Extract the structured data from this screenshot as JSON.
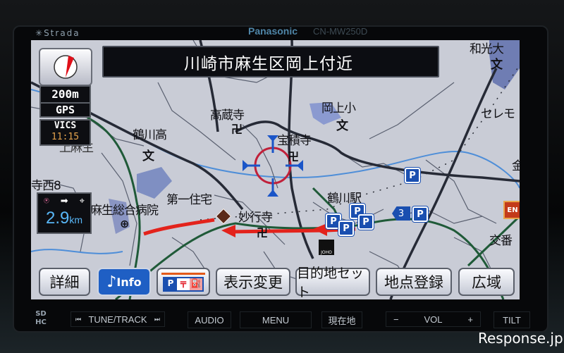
{
  "device": {
    "brand": "Strada",
    "manufacturer": "Panasonic",
    "model": "CN-MW250D",
    "watermark": "Response.jp"
  },
  "navigation": {
    "address_bar": "川崎市麻生区岡上付近",
    "compass": "compass-icon",
    "scale": "200m",
    "gps_status": "GPS",
    "vics_label": "VICS",
    "vics_time": "11:15",
    "distance_value": "2.9",
    "distance_unit": "km"
  },
  "map_labels": [
    {
      "text": "高蔵寺",
      "kind": "temple"
    },
    {
      "text": "宝積寺",
      "kind": "temple"
    },
    {
      "text": "岡上小",
      "kind": "school"
    },
    {
      "text": "鶴川高",
      "kind": "school"
    },
    {
      "text": "麻生総合病院",
      "kind": "hospital"
    },
    {
      "text": "第一住宅",
      "kind": "area"
    },
    {
      "text": "妙行寺",
      "kind": "temple"
    },
    {
      "text": "鶴川駅",
      "kind": "station"
    },
    {
      "text": "セレモ",
      "kind": "area"
    },
    {
      "text": "寺西8",
      "kind": "area"
    },
    {
      "text": "上麻生",
      "kind": "area"
    },
    {
      "text": "和光大",
      "kind": "school"
    },
    {
      "text": "金",
      "kind": "area"
    },
    {
      "text": "交番",
      "kind": "police"
    }
  ],
  "parking": [
    {
      "label": "P"
    },
    {
      "label": "P"
    },
    {
      "label": "P"
    },
    {
      "label": "P"
    },
    {
      "label": "P"
    },
    {
      "label": "P"
    }
  ],
  "exit_badge": "3",
  "eneos_label": "EN",
  "joho_label": "JOHO",
  "buttons": [
    {
      "label": "詳細",
      "name": "details-button"
    },
    {
      "label": "Info",
      "name": "info-button",
      "icon": "music-note-icon"
    },
    {
      "label": "P〒⛽",
      "name": "poi-filter-button"
    },
    {
      "label": "表示変更",
      "name": "display-change-button"
    },
    {
      "label": "目的地セット",
      "name": "set-destination-button"
    },
    {
      "label": "地点登録",
      "name": "register-location-button"
    },
    {
      "label": "広域",
      "name": "wide-area-button"
    }
  ],
  "hardware": {
    "sd_label": "SD HC",
    "prev_icon": "⏮",
    "tune_track": "TUNE/TRACK",
    "next_icon": "⏭",
    "audio": "AUDIO",
    "menu": "MENU",
    "current_location": "現在地",
    "vol_minus": "−",
    "vol": "VOL",
    "vol_plus": "+",
    "tilt": "TILT"
  },
  "colors": {
    "map_bg": "#c9ccd6",
    "route_red": "#e3231c",
    "road_green": "#1f5a38",
    "info_blue": "#1f5fc4",
    "distance_blue": "#58b6f6",
    "vics_orange": "#e4a34d"
  }
}
